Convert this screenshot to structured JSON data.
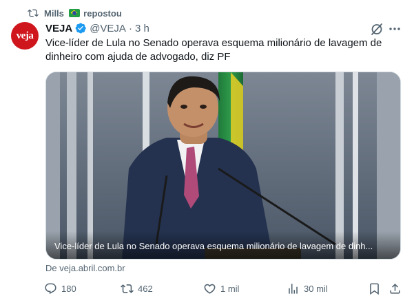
{
  "repost": {
    "user": "Mills",
    "label": "repostou"
  },
  "author": {
    "avatar_text": "veja",
    "name": "VEJA",
    "handle": "@VEJA",
    "separator": "·",
    "time": "3 h"
  },
  "tweet": {
    "text": "Vice-líder de Lula no Senado operava esquema milionário de lavagem de dinheiro com ajuda de advogado, diz PF"
  },
  "media": {
    "caption": "Vice-líder de Lula no Senado operava esquema milionário de lavagem de dinh..."
  },
  "source": {
    "text": "De veja.abril.com.br"
  },
  "actions": {
    "replies": "180",
    "reposts": "462",
    "likes": "1 mil",
    "views": "30 mil"
  },
  "colors": {
    "accent": "#1d9bf0",
    "muted": "#536471",
    "brand": "#d0161d"
  },
  "icons": [
    "repost-icon",
    "brazil-flag-icon",
    "verified-badge-icon",
    "grok-icon",
    "more-icon",
    "reply-icon",
    "like-icon",
    "views-icon",
    "bookmark-icon",
    "share-icon"
  ]
}
